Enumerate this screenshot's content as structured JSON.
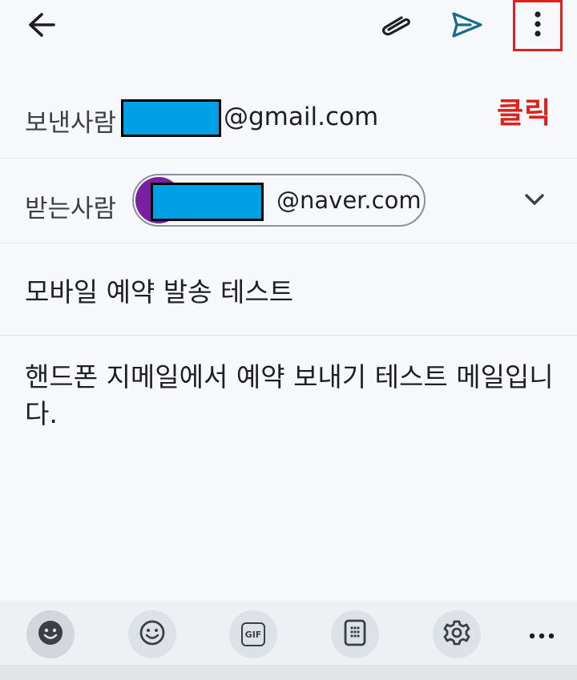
{
  "header": {
    "back_icon": "arrow-left-icon",
    "attach_icon": "paperclip-icon",
    "send_icon": "send-icon",
    "more_icon": "more-vertical-icon",
    "annotation": "클릭",
    "annotation_color": "#e0201b"
  },
  "from": {
    "label": "보낸사람",
    "email_suffix": "@gmail.com"
  },
  "to": {
    "label": "받는사람",
    "email_suffix": "@naver.com",
    "avatar_color": "#7b1fa2"
  },
  "subject": "모바일 예약 발송 테스트",
  "body": "핸드폰 지메일에서 예약 보내기 테스트 메일입니다.",
  "keyboard_toolbar": {
    "items": [
      "emoji-keyboard-icon",
      "smiley-icon",
      "gif-icon",
      "clipboard-icon",
      "settings-icon",
      "more-horizontal-icon"
    ],
    "gif_label": "GIF"
  },
  "colors": {
    "accent": "#0b57d0",
    "send": "#1a6a8f",
    "redaction": "#00a0e6"
  }
}
